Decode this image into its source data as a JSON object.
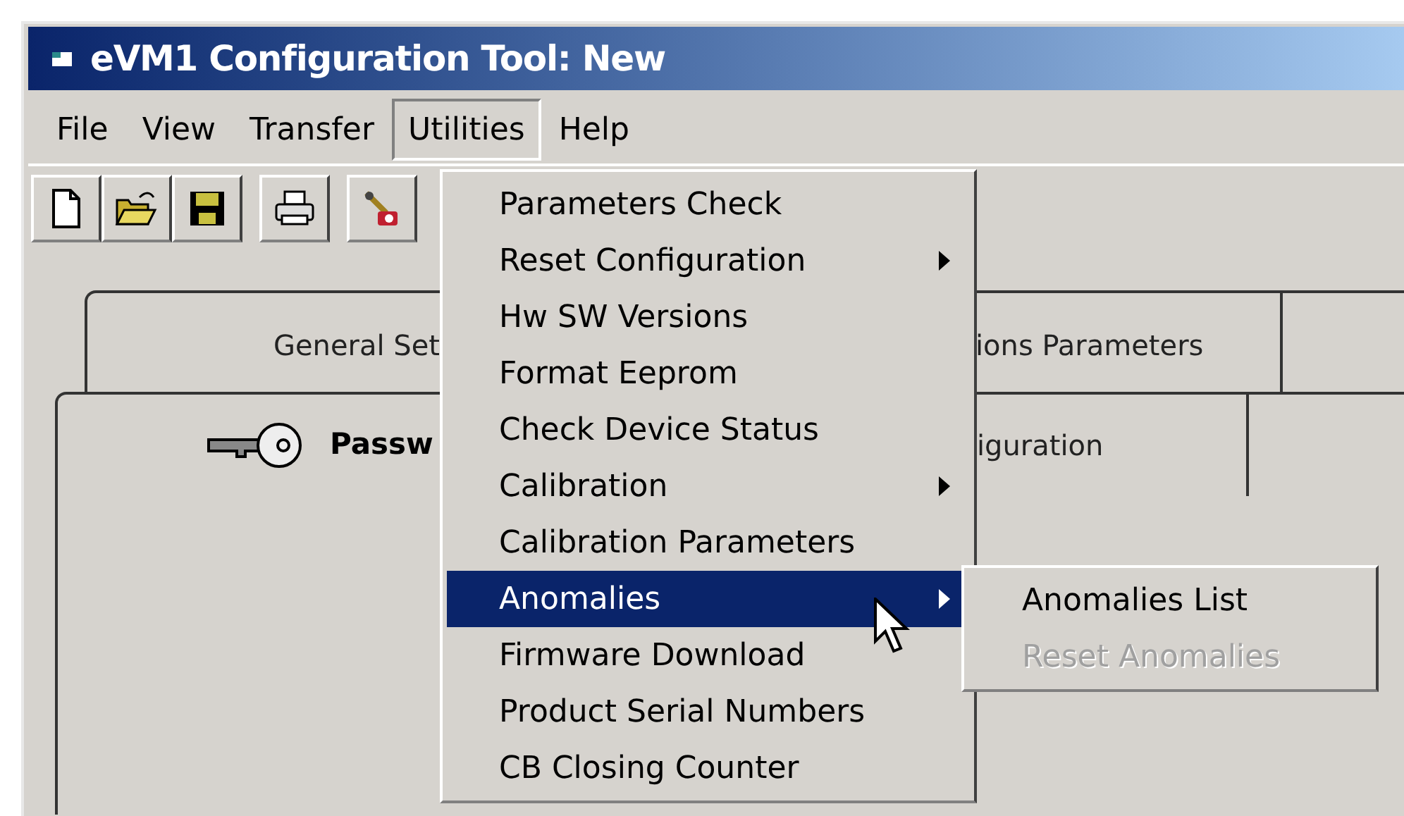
{
  "window": {
    "title": "eVM1 Configuration Tool: New"
  },
  "menu_bar": [
    {
      "label": "File",
      "selected": false
    },
    {
      "label": "View",
      "selected": false
    },
    {
      "label": "Transfer",
      "selected": false
    },
    {
      "label": "Utilities",
      "selected": true
    },
    {
      "label": "Help",
      "selected": false
    }
  ],
  "toolbar": [
    {
      "kind": "new"
    },
    {
      "kind": "open"
    },
    {
      "kind": "save"
    },
    {
      "kind": "gap"
    },
    {
      "kind": "print"
    },
    {
      "kind": "gap"
    },
    {
      "kind": "tool"
    }
  ],
  "tabs_row_1": {
    "left_label": "General Set",
    "right_label": "ions Parameters"
  },
  "tabs_row_2": {
    "password_label": "Passw",
    "right_label": "iguration"
  },
  "utilities_menu": [
    {
      "label": "Parameters Check",
      "submenu": false,
      "selected": false
    },
    {
      "label": "Reset Configuration",
      "submenu": true,
      "selected": false
    },
    {
      "label": "Hw SW Versions",
      "submenu": false,
      "selected": false
    },
    {
      "label": "Format Eeprom",
      "submenu": false,
      "selected": false
    },
    {
      "label": "Check Device Status",
      "submenu": false,
      "selected": false
    },
    {
      "label": "Calibration",
      "submenu": true,
      "selected": false
    },
    {
      "label": "Calibration Parameters",
      "submenu": false,
      "selected": false
    },
    {
      "label": "Anomalies",
      "submenu": true,
      "selected": true
    },
    {
      "label": "Firmware Download",
      "submenu": false,
      "selected": false
    },
    {
      "label": "Product Serial Numbers",
      "submenu": false,
      "selected": false
    },
    {
      "label": "CB Closing Counter",
      "submenu": false,
      "selected": false
    }
  ],
  "anomalies_submenu": [
    {
      "label": "Anomalies List",
      "disabled": false
    },
    {
      "label": "Reset Anomalies",
      "disabled": true
    }
  ]
}
